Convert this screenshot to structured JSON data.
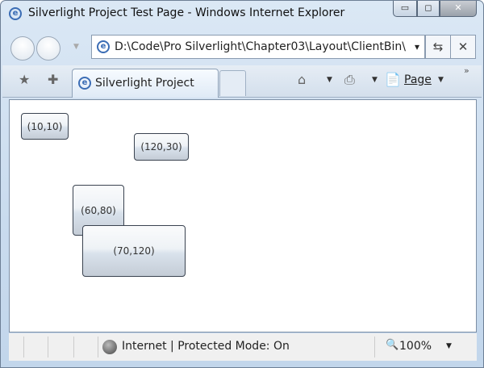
{
  "window": {
    "title": "Silverlight Project Test Page - Windows Internet Explorer",
    "minimize": "▭",
    "maximize": "◻",
    "close": "✕"
  },
  "address": {
    "url": "D:\\Code\\Pro Silverlight\\Chapter03\\Layout\\ClientBin\\",
    "dropdown": "▾",
    "refresh": "⇆",
    "stop": "✕"
  },
  "toolbar": {
    "tab_title": "Silverlight Project Test P...",
    "page_label": "Page",
    "more": "»"
  },
  "buttons": [
    {
      "label": "(10,10)"
    },
    {
      "label": "(120,30)"
    },
    {
      "label": "(60,80)"
    },
    {
      "label": "(70,120)"
    }
  ],
  "status": {
    "zone": "Internet | Protected Mode: On",
    "zoom": "100%"
  }
}
